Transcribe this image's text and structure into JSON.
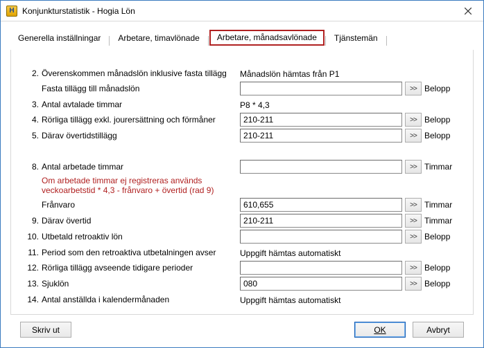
{
  "window": {
    "title": "Konjunkturstatistik - Hogia Lön"
  },
  "tabs": {
    "t0": "Generella inställningar",
    "t1": "Arbetare, timavlönade",
    "t2": "Arbetare, månadsavlönade",
    "t3": "Tjänstemän"
  },
  "rows": {
    "r2": {
      "num": "2.",
      "label": "Överenskommen månadslön inklusive fasta tillägg",
      "static": "Månadslön hämtas från P1"
    },
    "r2b": {
      "num": "",
      "label": "Fasta tillägg till månadslön",
      "value": "",
      "unit": "Belopp"
    },
    "r3": {
      "num": "3.",
      "label": "Antal avtalade timmar",
      "static": "P8 * 4,3"
    },
    "r4": {
      "num": "4.",
      "label": "Rörliga tillägg exkl. jourersättning och förmåner",
      "value": "210-211",
      "unit": "Belopp"
    },
    "r5": {
      "num": "5.",
      "label": "Därav övertidstillägg",
      "value": "210-211",
      "unit": "Belopp"
    },
    "r8": {
      "num": "8.",
      "label": "Antal arbetade timmar",
      "value": "",
      "unit": "Timmar"
    },
    "r8n": {
      "label": "Om arbetade timmar ej registreras används veckoarbetstid * 4,3 - frånvaro + övertid (rad 9)"
    },
    "r8f": {
      "num": "",
      "label": "Frånvaro",
      "value": "610,655",
      "unit": "Timmar"
    },
    "r9": {
      "num": "9.",
      "label": "Därav övertid",
      "value": "210-211",
      "unit": "Timmar"
    },
    "r10": {
      "num": "10.",
      "label": "Utbetald retroaktiv lön",
      "value": "",
      "unit": "Belopp"
    },
    "r11": {
      "num": "11.",
      "label": "Period som den retroaktiva utbetalningen avser",
      "static": "Uppgift hämtas automatiskt"
    },
    "r12": {
      "num": "12.",
      "label": "Rörliga tillägg avseende tidigare perioder",
      "value": "",
      "unit": "Belopp"
    },
    "r13": {
      "num": "13.",
      "label": "Sjuklön",
      "value": "080",
      "unit": "Belopp"
    },
    "r14": {
      "num": "14.",
      "label": "Antal anställda i kalendermånaden",
      "static": "Uppgift hämtas automatiskt"
    }
  },
  "buttons": {
    "print": "Skriv ut",
    "ok": "OK",
    "cancel": "Avbryt",
    "arrow": ">>"
  }
}
